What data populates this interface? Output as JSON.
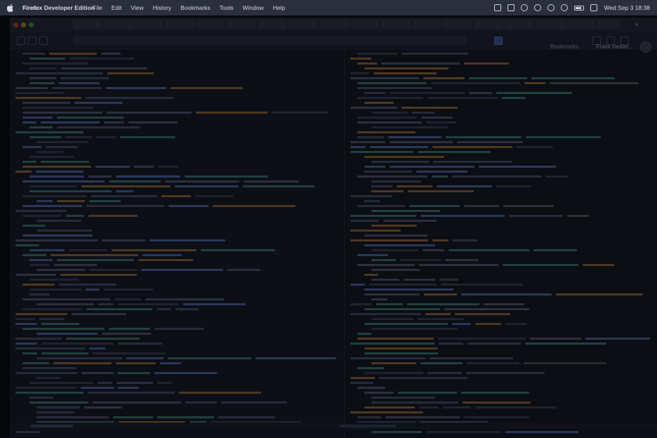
{
  "menubar": {
    "app_name": "Firefox Developer Edition",
    "app_name_ghost": "Xcode",
    "items": [
      "File",
      "Edit",
      "View",
      "History",
      "Bookmarks",
      "Tools",
      "Window",
      "Help"
    ],
    "clock": "Wed Sep 3  18:38",
    "status_icons": [
      "app-icon",
      "app-icon",
      "accessibility-icon",
      "mic-icon",
      "play-icon",
      "time-machine-icon",
      "battery-icon",
      "control-center-icon"
    ]
  },
  "browser": {
    "bookmarks_label": "Bookmarks",
    "user_name": "Frank Heiber...",
    "tab_close": "×"
  },
  "colors": {
    "background": "#0b0c11",
    "menubar": "#2b2e3b",
    "code_accent_blue": "#3a4a78",
    "code_accent_orange": "#6b4a2a",
    "code_accent_teal": "#2d5552"
  }
}
